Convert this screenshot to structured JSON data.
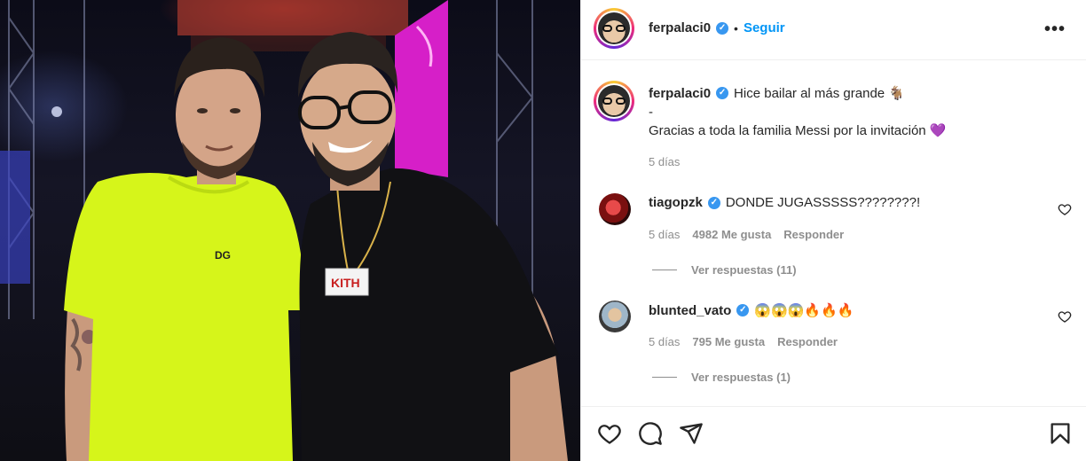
{
  "post": {
    "author": "ferpalaci0",
    "follow_label": "Seguir",
    "separator": "•",
    "more_label": "•••",
    "caption_line1": "Hice bailar al más grande 🐐",
    "caption_dash": "-",
    "caption_line2": "Gracias a toda la familia Messi por la invitación 💜",
    "caption_time": "5 días"
  },
  "comments": [
    {
      "username": "tiagopzk",
      "text": "DONDE JUGASSSSS????????!",
      "time": "5 días",
      "likes": "4982 Me gusta",
      "reply_label": "Responder",
      "view_replies": "Ver respuestas (11)"
    },
    {
      "username": "blunted_vato",
      "text": "😱😱😱🔥🔥🔥",
      "time": "5 días",
      "likes": "795 Me gusta",
      "reply_label": "Responder",
      "view_replies": "Ver respuestas (1)"
    }
  ],
  "icons": {
    "verified": "verified-badge-icon",
    "like": "heart-icon",
    "comment": "comment-icon",
    "share": "share-icon",
    "save": "bookmark-icon",
    "more": "more-options-icon"
  },
  "colors": {
    "accent_blue": "#0095f6",
    "verified_blue": "#3897f0",
    "muted_text": "#8e8e8e",
    "shirt_yellow": "#d6f51a",
    "stage_magenta": "#d61fc8"
  },
  "photo": {
    "shirt_logo": "DG",
    "pendant_text": "KITH"
  }
}
